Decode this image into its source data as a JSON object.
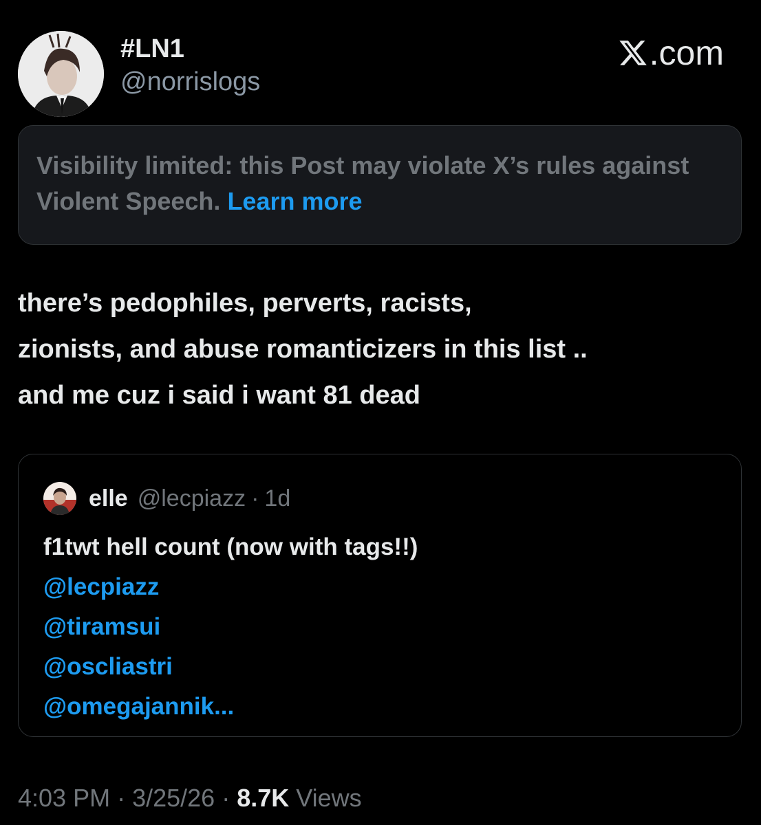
{
  "author": {
    "display_name": "#LN1",
    "handle": "@norrislogs"
  },
  "brand": {
    "label": ".com",
    "icon": "x-logo-icon"
  },
  "notice": {
    "text": "Visibility limited: this Post may violate X’s rules against Violent Speech.",
    "link_label": "Learn more"
  },
  "post": {
    "lines": [
      "there’s pedophiles, perverts, racists,",
      "zionists, and abuse romanticizers in this list ..",
      "and me cuz i said i want 81 dead"
    ]
  },
  "quote": {
    "name": "elle",
    "handle": "@lecpiazz",
    "separator": "·",
    "time": "1d",
    "text": "f1twt hell count (now with tags!!)",
    "mentions": [
      "@lecpiazz",
      "@tiramsui",
      "@oscliastri",
      "@omegajannik..."
    ]
  },
  "meta": {
    "time": "4:03 PM",
    "date": "3/25/26",
    "separator": "·",
    "views_count": "8.7K",
    "views_label": "Views"
  },
  "colors": {
    "background": "#000000",
    "primary_text": "#e7e9ea",
    "secondary_text": "#71767b",
    "link": "#1d9bf0",
    "border": "#2f3336"
  }
}
